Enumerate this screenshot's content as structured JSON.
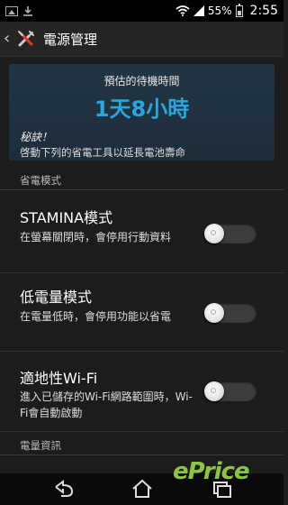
{
  "status_bar": {
    "battery_percent": "55%",
    "time": "2:55",
    "battery_level": 0.55
  },
  "action_bar": {
    "title": "電源管理"
  },
  "estimate": {
    "caption": "預估的待機時間",
    "value": "1天8小時",
    "tip_title": "秘訣！",
    "tip_text": "啓動下列的省電工具以延長電池壽命"
  },
  "sections": {
    "power_saving": "省電模式",
    "power_info": "電量資訊"
  },
  "settings": [
    {
      "title": "STAMINA模式",
      "description": "在螢幕關閉時，會停用行動資料",
      "enabled": false
    },
    {
      "title": "低電量模式",
      "description": "在電量低時，會停用功能以省電",
      "enabled": false
    },
    {
      "title": "適地性Wi-Fi",
      "description": "進入已儲存的Wi-Fi網路範圍時，Wi-Fi會自動啟動",
      "enabled": false
    }
  ],
  "watermark": {
    "text": "ePrice"
  },
  "colors": {
    "accent": "#2aa6df",
    "watermark": "#8cc63f"
  }
}
